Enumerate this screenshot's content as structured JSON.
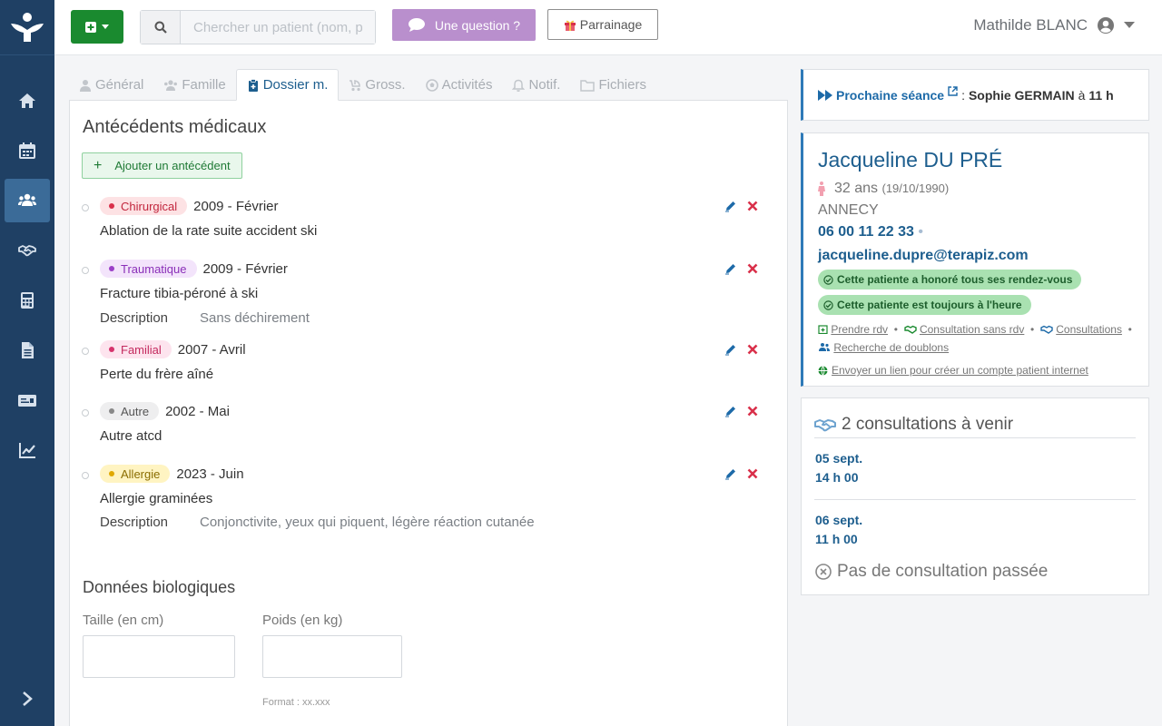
{
  "topbar": {
    "search_placeholder": "Chercher un patient (nom, pré",
    "question_label": "Une question ?",
    "parrainage_label": "Parrainage",
    "user_name": "Mathilde BLANC"
  },
  "tabs": [
    {
      "label": "Général",
      "icon": "user-icon"
    },
    {
      "label": "Famille",
      "icon": "users-icon"
    },
    {
      "label": "Dossier m.",
      "icon": "clipboard-icon"
    },
    {
      "label": "Gross.",
      "icon": "baby-carriage-icon"
    },
    {
      "label": "Activités",
      "icon": "soccer-ball-icon"
    },
    {
      "label": "Notif.",
      "icon": "bell-icon"
    },
    {
      "label": "Fichiers",
      "icon": "folder-icon"
    }
  ],
  "medical": {
    "title": "Antécédents médicaux",
    "add_label": "Ajouter un antécédent",
    "description_label": "Description",
    "items": [
      {
        "category": "Chirurgical",
        "color": "#d9304a",
        "bg": "#fde2e4",
        "date": "2009 - Février",
        "title": "Ablation de la rate suite accident ski",
        "description": ""
      },
      {
        "category": "Traumatique",
        "color": "#9b3fc8",
        "bg": "#f3e4fb",
        "date": "2009 - Février",
        "title": "Fracture tibia-péroné à ski",
        "description": "Sans déchirement"
      },
      {
        "category": "Familial",
        "color": "#d6336c",
        "bg": "#fde4ee",
        "date": "2007 - Avril",
        "title": "Perte du frère aîné",
        "description": ""
      },
      {
        "category": "Autre",
        "color": "#888888",
        "bg": "#eeeeef",
        "date": "2002 - Mai",
        "title": "Autre atcd",
        "description": ""
      },
      {
        "category": "Allergie",
        "color": "#e0a800",
        "bg": "#fff4c2",
        "date": "2023 - Juin",
        "title": "Allergie graminées",
        "description": "Conjonctivite, yeux qui piquent, légère réaction cutanée"
      }
    ]
  },
  "bio": {
    "title": "Données biologiques",
    "height_label": "Taille (en cm)",
    "weight_label": "Poids (en kg)",
    "height_value": "",
    "weight_value": "",
    "weight_format": "Format : xx.xxx"
  },
  "next_session": {
    "label": "Prochaine séance",
    "sep": ":",
    "name": "Sophie GERMAIN",
    "at": "à",
    "time": "11 h"
  },
  "patient": {
    "name": "Jacqueline DU PRÉ",
    "age": "32 ans",
    "birthdate": "(19/10/1990)",
    "city": "ANNECY",
    "phone": "06 00 11 22 33",
    "email": "jacqueline.dupre@terapiz.com",
    "badges": [
      "Cette patiente a honoré tous ses rendez-vous",
      "Cette patiente est toujours à l'heure"
    ],
    "links": [
      "Prendre rdv",
      "Consultation sans rdv",
      "Consultations",
      "Recherche de doublons"
    ],
    "account_link": "Envoyer un lien pour créer un compte patient internet"
  },
  "consultations": {
    "title": "2 consultations à venir",
    "upcoming": [
      {
        "date": "05 sept.",
        "time": "14 h 00"
      },
      {
        "date": "06 sept.",
        "time": "11 h 00"
      }
    ],
    "none_past": "Pas de consultation passée"
  },
  "colors": {
    "sidebar": "#1f4064",
    "primary": "#1d5e8e",
    "green": "#1a8a2f",
    "purple": "#b98fcd"
  }
}
